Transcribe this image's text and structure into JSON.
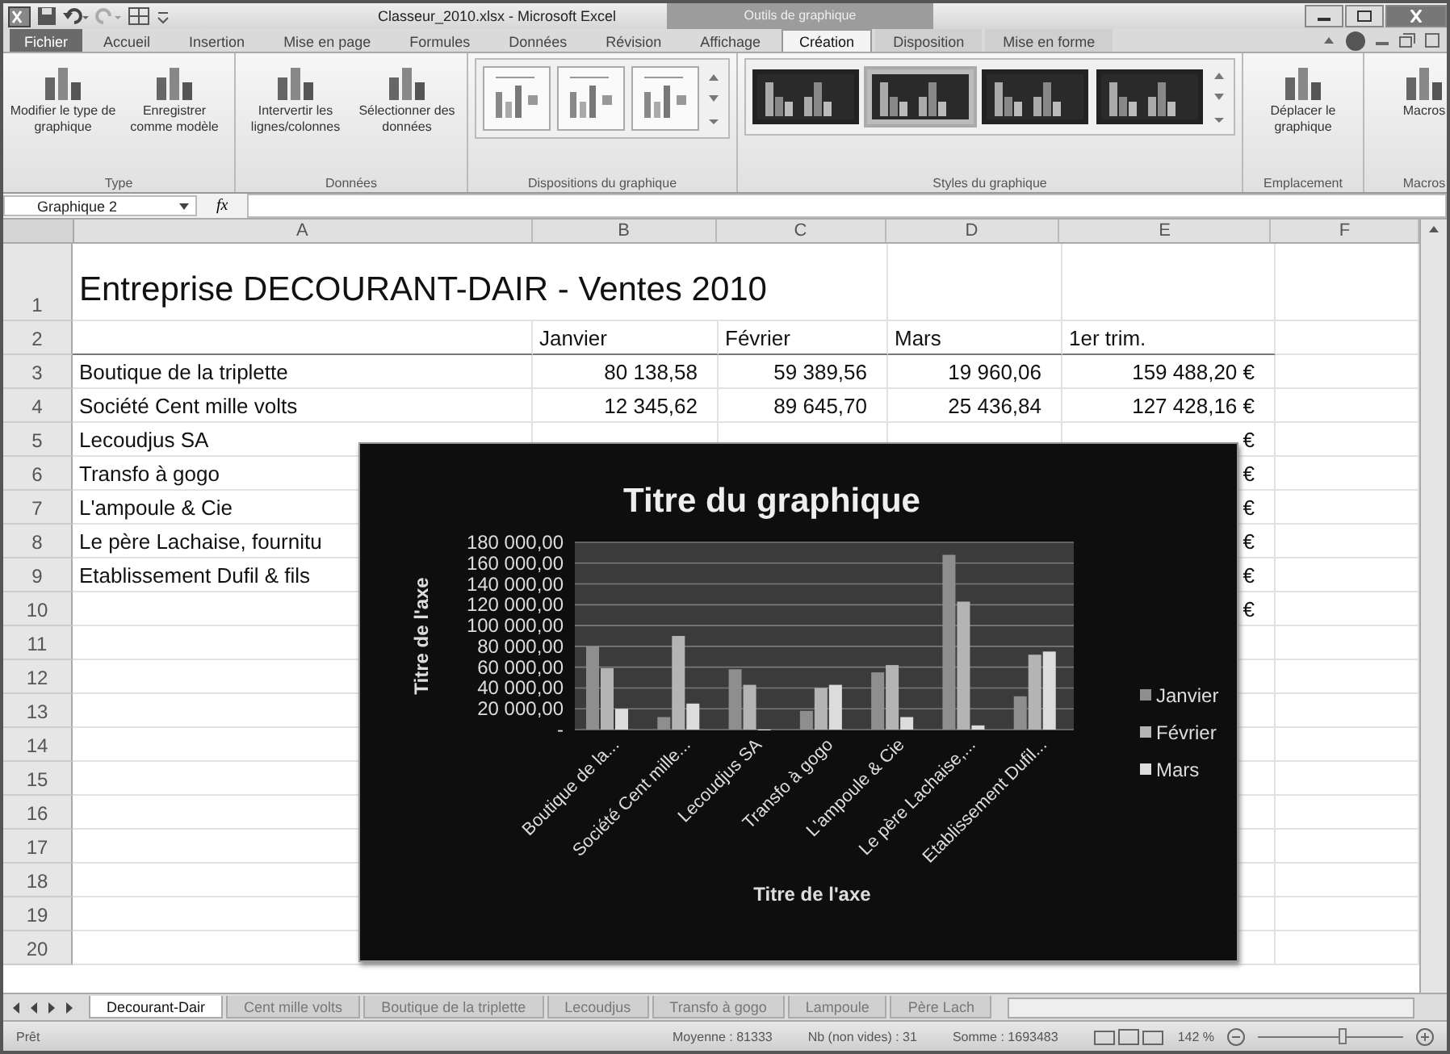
{
  "window": {
    "title": "Classeur_2010.xlsx - Microsoft Excel"
  },
  "contextual_group": {
    "label": "Outils de graphique"
  },
  "tabs": [
    {
      "label": "Fichier",
      "kind": "file",
      "selected": false
    },
    {
      "label": "Accueil",
      "kind": "normal",
      "selected": false
    },
    {
      "label": "Insertion",
      "kind": "normal",
      "selected": false
    },
    {
      "label": "Mise en page",
      "kind": "normal",
      "selected": false
    },
    {
      "label": "Formules",
      "kind": "normal",
      "selected": false
    },
    {
      "label": "Données",
      "kind": "normal",
      "selected": false
    },
    {
      "label": "Révision",
      "kind": "normal",
      "selected": false
    },
    {
      "label": "Affichage",
      "kind": "normal",
      "selected": false
    },
    {
      "label": "Création",
      "kind": "contextual",
      "selected": true
    },
    {
      "label": "Disposition",
      "kind": "contextual",
      "selected": false
    },
    {
      "label": "Mise en forme",
      "kind": "contextual",
      "selected": false
    }
  ],
  "ribbon": [
    {
      "label": "Type",
      "kind": "buttons",
      "buttons": [
        "Modifier le type de graphique",
        "Enregistrer comme modèle"
      ]
    },
    {
      "label": "Données",
      "kind": "buttons",
      "buttons": [
        "Intervertir les lignes/colonnes",
        "Sélectionner des données"
      ]
    },
    {
      "label": "Dispositions du graphique",
      "kind": "layouts",
      "items": [
        {
          "selected": false
        },
        {
          "selected": false
        },
        {
          "selected": false
        }
      ]
    },
    {
      "label": "Styles du graphique",
      "kind": "styles",
      "items": [
        {
          "selected": false
        },
        {
          "selected": true
        },
        {
          "selected": false
        },
        {
          "selected": false
        }
      ]
    },
    {
      "label": "Emplacement",
      "kind": "buttons",
      "buttons": [
        "Déplacer le graphique"
      ]
    },
    {
      "label": "Macros",
      "kind": "buttons",
      "buttons": [
        "Macros"
      ]
    }
  ],
  "formula_bar": {
    "name_box": "Graphique 2",
    "fx": "fx"
  },
  "columns": [
    "A",
    "B",
    "C",
    "D",
    "E",
    "F"
  ],
  "rows": [
    {
      "n": "1",
      "kind": "title",
      "a": "Entreprise DECOURANT-DAIR - Ventes 2010"
    },
    {
      "n": "2",
      "kind": "header",
      "b": "Janvier",
      "c": "Février",
      "d": "Mars",
      "e": "1er trim."
    },
    {
      "n": "3",
      "kind": "data",
      "a": "Boutique de la triplette",
      "b": "80 138,58",
      "c": "59 389,56",
      "d": "19 960,06",
      "e": "159 488,20 €"
    },
    {
      "n": "4",
      "kind": "data",
      "a": "Société Cent mille volts",
      "b": "12 345,62",
      "c": "89 645,70",
      "d": "25 436,84",
      "e": "127 428,16 €"
    },
    {
      "n": "5",
      "kind": "data",
      "a": "Lecoudjus SA",
      "e": "€"
    },
    {
      "n": "6",
      "kind": "data",
      "a": "Transfo à gogo",
      "e": "€"
    },
    {
      "n": "7",
      "kind": "data",
      "a": "L'ampoule & Cie",
      "e": "€"
    },
    {
      "n": "8",
      "kind": "data",
      "a": "Le père Lachaise, fournitu",
      "e": "€"
    },
    {
      "n": "9",
      "kind": "data",
      "a": "Etablissement Dufil & fils",
      "e": "€"
    },
    {
      "n": "10",
      "kind": "data",
      "e": "€"
    },
    {
      "n": "11",
      "kind": "data"
    },
    {
      "n": "12",
      "kind": "data"
    },
    {
      "n": "13",
      "kind": "data"
    },
    {
      "n": "14",
      "kind": "data"
    },
    {
      "n": "15",
      "kind": "data"
    },
    {
      "n": "16",
      "kind": "data"
    },
    {
      "n": "17",
      "kind": "data"
    },
    {
      "n": "18",
      "kind": "data"
    },
    {
      "n": "19",
      "kind": "data"
    },
    {
      "n": "20",
      "kind": "data"
    }
  ],
  "chart": {
    "chart_data": {
      "type": "bar",
      "title": "Titre du graphique",
      "xlabel": "Titre de l'axe",
      "ylabel": "Titre de l'axe",
      "categories": [
        "Boutique de la...",
        "Société Cent mille...",
        "Lecoudjus SA",
        "Transfo à gogo",
        "L'ampoule & Cie",
        "Le père Lachaise,...",
        "Etablissement Dufil..."
      ],
      "series": [
        {
          "name": "Janvier",
          "color": "#8e8e8e",
          "values": [
            80000,
            12000,
            58000,
            18000,
            55000,
            168000,
            32000
          ]
        },
        {
          "name": "Février",
          "color": "#b4b4b4",
          "values": [
            59000,
            90000,
            43000,
            40000,
            62000,
            123000,
            72000
          ]
        },
        {
          "name": "Mars",
          "color": "#dcdcdc",
          "values": [
            20000,
            25000,
            0,
            43000,
            12000,
            4000,
            75000
          ]
        }
      ],
      "grid": true,
      "legend": true,
      "ylim": [
        0,
        180000
      ],
      "yticks": [
        {
          "value": 0,
          "label": "-"
        },
        {
          "value": 20000,
          "label": "20 000,00"
        },
        {
          "value": 40000,
          "label": "40 000,00"
        },
        {
          "value": 60000,
          "label": "60 000,00"
        },
        {
          "value": 80000,
          "label": "80 000,00"
        },
        {
          "value": 100000,
          "label": "100 000,00"
        },
        {
          "value": 120000,
          "label": "120 000,00"
        },
        {
          "value": 140000,
          "label": "140 000,00"
        },
        {
          "value": 160000,
          "label": "160 000,00"
        },
        {
          "value": 180000,
          "label": "180 000,00"
        }
      ]
    }
  },
  "sheet_tabs": [
    {
      "label": "Decourant-Dair",
      "selected": true
    },
    {
      "label": "Cent mille volts",
      "selected": false
    },
    {
      "label": "Boutique de la triplette",
      "selected": false
    },
    {
      "label": "Lecoudjus",
      "selected": false
    },
    {
      "label": "Transfo à gogo",
      "selected": false
    },
    {
      "label": "Lampoule",
      "selected": false
    },
    {
      "label": "Père Lach",
      "selected": false
    }
  ],
  "status_bar": {
    "mode": "Prêt",
    "stats": [
      "Moyenne : 81333",
      "Nb (non vides) : 31",
      "Somme : 1693483"
    ],
    "zoom": "142 %",
    "zoom_level": {
      "level": 0.58
    }
  }
}
